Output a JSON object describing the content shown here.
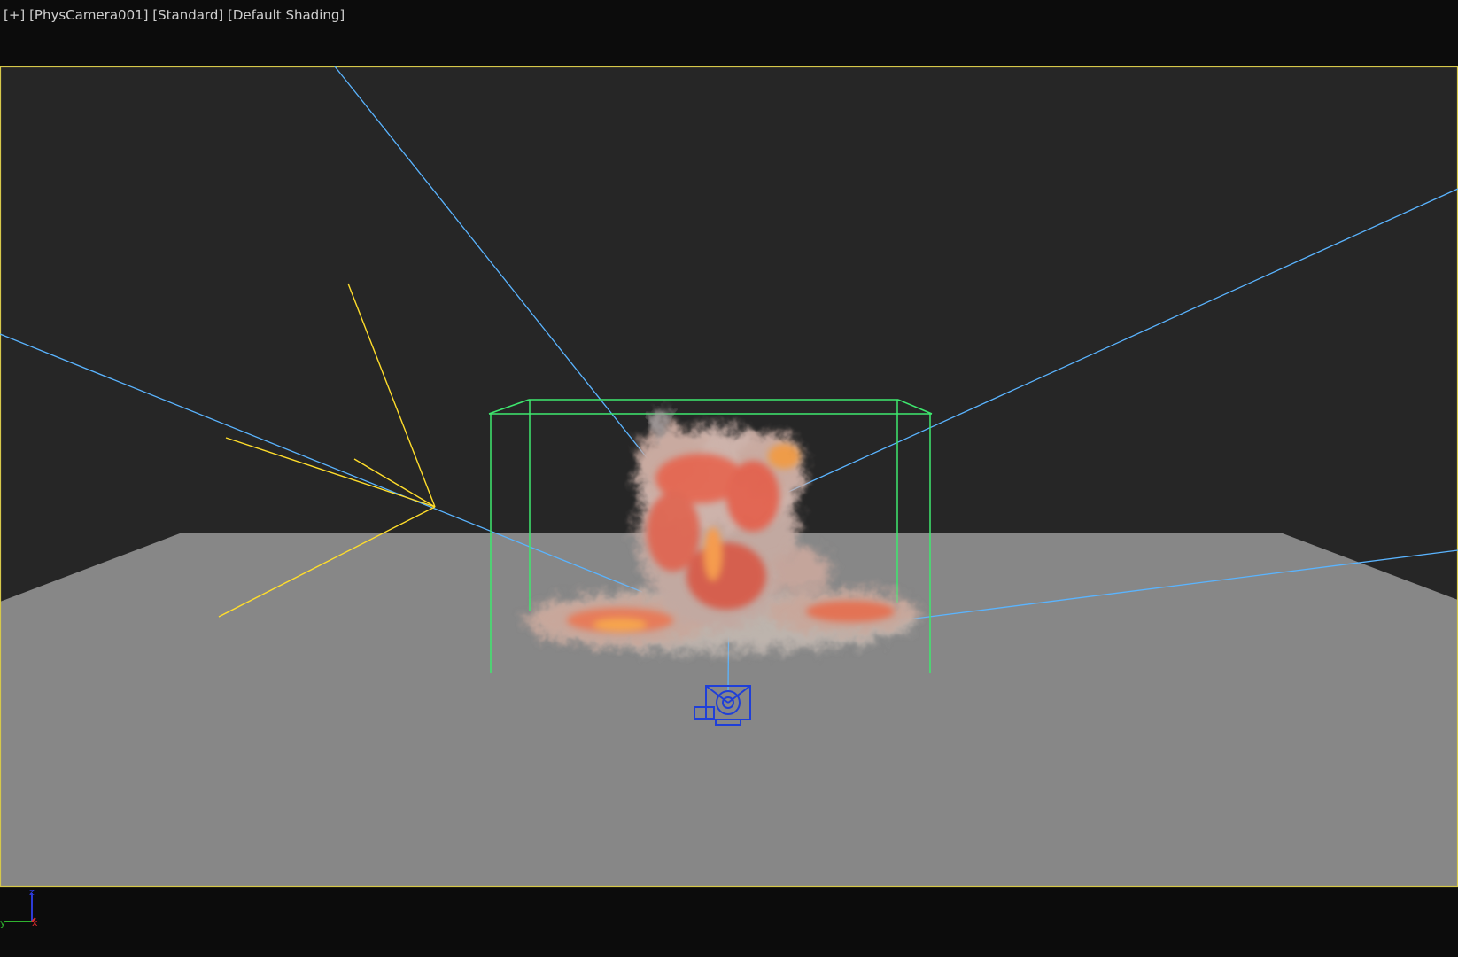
{
  "viewport": {
    "menu_plus": "[+]",
    "camera": "[PhysCamera001]",
    "visual_style": "[Standard]",
    "shading": "[Default Shading]"
  },
  "axis_gizmo": {
    "z_label": "z",
    "y_label": "y",
    "x_label": "x"
  },
  "colors": {
    "background": "#0c0c0c",
    "viewport_bg": "#262626",
    "ground_plane": "#878787",
    "active_border": "#d6c84a",
    "light_lines": "#5ab4ff",
    "target_lines": "#ffdd2b",
    "bounding_box": "#3ee86e",
    "camera_icon": "#1f3fd8"
  },
  "icons": {
    "camera": "physical-camera-icon",
    "gizmo": "axis-tripod-icon"
  }
}
